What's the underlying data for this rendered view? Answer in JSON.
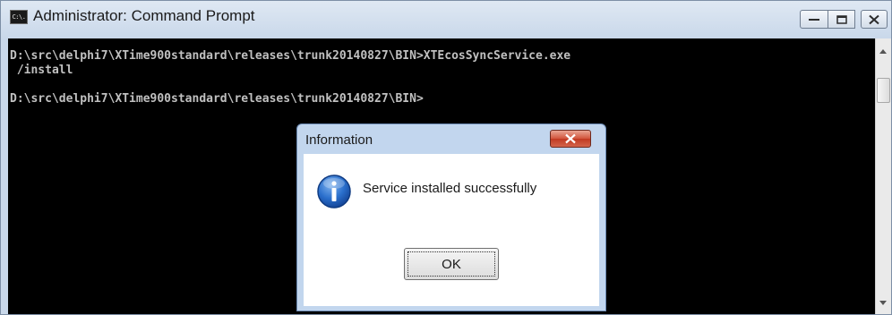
{
  "window": {
    "title": "Administrator: Command Prompt",
    "icon_text": "C:\\.",
    "controls": {
      "minimize": "minimize-icon",
      "maximize": "maximize-icon",
      "close": "close-icon"
    }
  },
  "console": {
    "lines": [
      "D:\\src\\delphi7\\XTime900standard\\releases\\trunk20140827\\BIN>XTEcosSyncService.exe",
      " /install",
      "",
      "D:\\src\\delphi7\\XTime900standard\\releases\\trunk20140827\\BIN>"
    ]
  },
  "dialog": {
    "title": "Information",
    "message": "Service installed successfully",
    "ok_label": "OK",
    "icon": "info-icon"
  },
  "colors": {
    "console_bg": "#000000",
    "console_text": "#c0c0c0",
    "dialog_close": "#c94c36",
    "info_icon": "#1f5fb8"
  }
}
